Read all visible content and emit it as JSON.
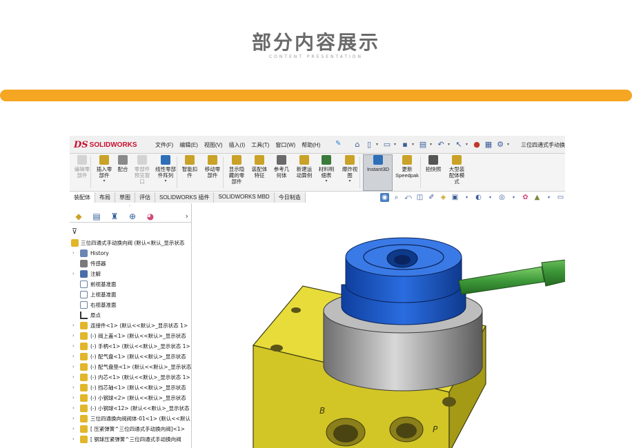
{
  "page": {
    "title": "部分内容展示",
    "subtitle": "CONTENT PRESENTATION"
  },
  "titlebar": {
    "logo_ds": "DS",
    "logo_name": "SOLIDWORKS",
    "menu": [
      "文件(F)",
      "编辑(E)",
      "视图(V)",
      "插入(I)",
      "工具(T)",
      "窗口(W)",
      "帮助(H)"
    ],
    "document_title": "三位四通式手动换"
  },
  "ribbon": {
    "buttons": [
      {
        "label": "编辑零\n部件",
        "disabled": true,
        "icon": "edit-component-icon"
      },
      {
        "label": "插入零\n部件",
        "disabled": false,
        "icon": "insert-component-icon"
      },
      {
        "label": "配合",
        "disabled": false,
        "icon": "mate-icon"
      },
      {
        "label": "零部件\n预览窗\n口",
        "disabled": true,
        "icon": "component-preview-icon"
      },
      {
        "label": "线性零部\n件阵列",
        "disabled": false,
        "icon": "linear-pattern-icon"
      },
      {
        "label": "智能扣\n件",
        "disabled": false,
        "icon": "smart-fastener-icon"
      },
      {
        "label": "移动零\n部件",
        "disabled": false,
        "icon": "move-component-icon"
      },
      {
        "label": "显示隐\n藏的零\n部件",
        "disabled": false,
        "icon": "show-hidden-icon"
      },
      {
        "label": "装配体\n特征",
        "disabled": false,
        "icon": "assembly-feature-icon"
      },
      {
        "label": "参考几\n何体",
        "disabled": false,
        "icon": "reference-geometry-icon"
      },
      {
        "label": "新建运\n动算例",
        "disabled": false,
        "icon": "motion-study-icon"
      },
      {
        "label": "材料明\n细表",
        "disabled": false,
        "icon": "bom-icon"
      },
      {
        "label": "爆炸视\n图",
        "disabled": false,
        "icon": "exploded-view-icon"
      },
      {
        "label": "Instant3D",
        "disabled": false,
        "icon": "instant3d-icon"
      },
      {
        "label": "更新\nSpeedpak",
        "disabled": false,
        "icon": "speedpak-icon"
      },
      {
        "label": "拍快照",
        "disabled": false,
        "icon": "snapshot-icon"
      },
      {
        "label": "大型装\n配体模\n式",
        "disabled": false,
        "icon": "large-assembly-icon"
      }
    ]
  },
  "tabs": [
    "装配体",
    "布局",
    "草图",
    "评估",
    "SOLIDWORKS 插件",
    "SOLIDWORKS MBD",
    "今日制造"
  ],
  "tree": {
    "root": "三位四通式手动换向阀 (默认<默认_显示状态",
    "items": [
      {
        "label": "History",
        "expand": true,
        "kind": "history"
      },
      {
        "label": "传感器",
        "expand": false,
        "kind": "sensor"
      },
      {
        "label": "注解",
        "expand": true,
        "kind": "annotation"
      },
      {
        "label": "前视基准面",
        "expand": false,
        "kind": "plane"
      },
      {
        "label": "上视基准面",
        "expand": false,
        "kind": "plane"
      },
      {
        "label": "右视基准面",
        "expand": false,
        "kind": "plane"
      },
      {
        "label": "原点",
        "expand": false,
        "kind": "origin"
      },
      {
        "label": "连接件<1> (默认<<默认>_显示状态 1>",
        "expand": true,
        "kind": "part"
      },
      {
        "label": "(-) 阀上盖<1> (默认<<默认>_显示状态",
        "expand": true,
        "kind": "part"
      },
      {
        "label": "(-) 手柄<1> (默认<<默认>_显示状态 1>",
        "expand": true,
        "kind": "part"
      },
      {
        "label": "(-) 配气盘<1> (默认<<默认>_显示状态",
        "expand": true,
        "kind": "part"
      },
      {
        "label": "(-) 配气盘垫<1> (默认<<默认>_显示状态",
        "expand": true,
        "kind": "part"
      },
      {
        "label": "(-) 内芯<1> (默认<<默认>_显示状态 1>",
        "expand": true,
        "kind": "part"
      },
      {
        "label": "(-) 挡芯轴<1> (默认<<默认>_显示状态",
        "expand": true,
        "kind": "part"
      },
      {
        "label": "(-) 小钢球<2> (默认<<默认>_显示状态",
        "expand": true,
        "kind": "part"
      },
      {
        "label": "(-) 小钢球<12> (默认<<默认>_显示状态",
        "expand": true,
        "kind": "part"
      },
      {
        "label": "三位四通换向阀阀体-01<1> (默认<<默认",
        "expand": true,
        "kind": "part"
      },
      {
        "label": "[ 压紧弹簧^三位四通式手动换向阀]<1>",
        "expand": true,
        "kind": "part"
      },
      {
        "label": "[ 钢球压紧弹簧^三位四通式手动换向阀",
        "expand": true,
        "kind": "part"
      }
    ]
  },
  "viewport": {
    "port_labels": [
      "B",
      "P"
    ]
  },
  "colors": {
    "accent_bar": "#f5a623",
    "cap_blue": "#1f5fd0",
    "handle_green": "#3f9a3a",
    "body_yellow": "#d9cf2a",
    "ring_grey": "#9a9a9a"
  }
}
